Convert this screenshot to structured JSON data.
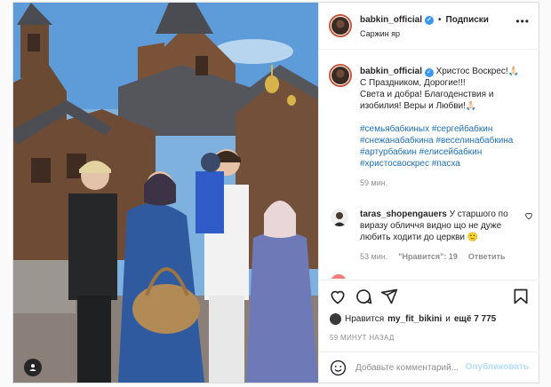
{
  "post": {
    "username": "babkin_official",
    "follow_label": "Подписки",
    "dot": "•",
    "more": "•••",
    "location": "Саржин яр",
    "caption_line1": "Христос Воскрес!🙏🏻",
    "caption_line2": "С Праздником, Дорогие!!!",
    "caption_line3": "Света и добра! Благоденствия и изобилия! Веры и Любви!🙏🏻",
    "hashtags": [
      "#семьябабкиных #сергейбабкин",
      "#снежанабабкина #веселинабабкина",
      "#артурбабкин #елисейбабкин",
      "#христосвоскрес #пасха"
    ],
    "caption_time": "59 мин."
  },
  "comment": {
    "username": "taras_shopengauers",
    "text": "У старшого по виразу обличчя видно що не дуже любить ходити до церкви 🙂",
    "time": "53 мин.",
    "likes": "\"Нравится\": 19",
    "reply": "Ответить"
  },
  "likes": {
    "prefix": "Нравится",
    "user": "my_fit_bikini",
    "conj": "и",
    "others": "ещё 7 775"
  },
  "posted_ago": "59 МИНУТ НАЗАД",
  "add_comment": {
    "placeholder": "Добавьте комментарий...",
    "publish": "Опубликовать"
  },
  "icons": {
    "heart": "heart-icon",
    "comment": "comment-icon",
    "share": "share-icon",
    "save": "bookmark-icon",
    "emoji": "emoji-icon",
    "tagged_user": "user-icon",
    "verified": "verified-icon"
  },
  "colors": {
    "hashtag": "#1d6fb8",
    "verified": "#3897f0",
    "publish_disabled": "#b3dbff",
    "muted": "#8e8e8e"
  }
}
